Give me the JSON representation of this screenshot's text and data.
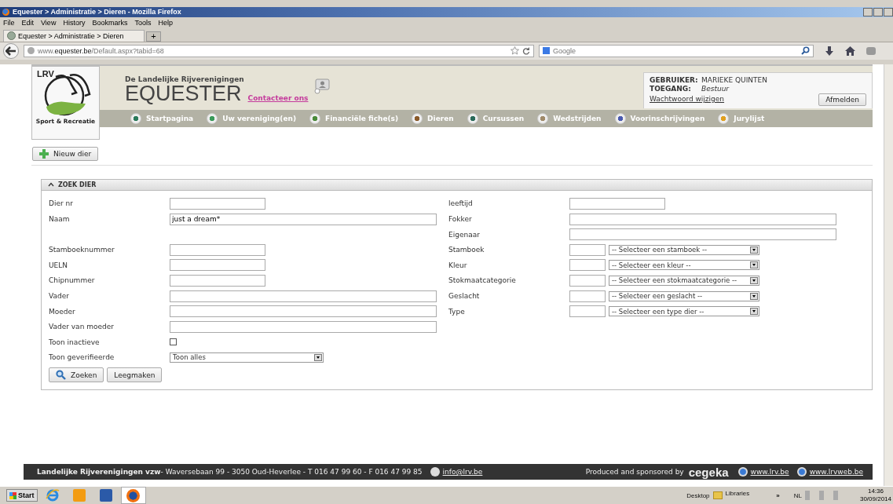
{
  "window": {
    "title": "Equester > Administratie > Dieren - Mozilla Firefox"
  },
  "menu": [
    "File",
    "Edit",
    "View",
    "History",
    "Bookmarks",
    "Tools",
    "Help"
  ],
  "tabs": [
    {
      "label": "Equester > Administratie > Dieren",
      "selected": true
    }
  ],
  "tab_add": "+",
  "address_bar": {
    "url": "www.**equester.be**/Default.aspx?tabid=68"
  },
  "search_bar": {
    "placeholder": "Google"
  },
  "header": {
    "logo_title": "LRV",
    "logo_caption": "Sport & Recreatie",
    "org": "De Landelijke Rijverenigingen",
    "app": "EQUESTER",
    "contact_link": "Contacteer ons"
  },
  "user_box": {
    "user_label": "GEBRUIKER:",
    "user": "MARIEKE QUINTEN",
    "access_label": "TOEGANG:",
    "access": "Bestuur",
    "password_link": "Wachtwoord wijzigen",
    "logout": "Afmelden"
  },
  "nav": [
    "Startpagina",
    "Uw vereniging(en)",
    "Financiële fiche(s)",
    "Dieren",
    "Cursussen",
    "Wedstrijden",
    "Voorinschrijvingen",
    "Jurylijst"
  ],
  "new_button": "Nieuw dier",
  "panel": {
    "title": "ZOEK DIER",
    "expanded": true,
    "rows": [
      {
        "left": {
          "kind": "short_text",
          "label": "Dier nr"
        },
        "right": {
          "kind": "short_text",
          "label": "leeftijd"
        }
      },
      {
        "left": {
          "kind": "text",
          "label": "Naam",
          "value": "just a dream*"
        },
        "right": {
          "kind": "text",
          "label": "Fokker"
        }
      },
      {
        "right": {
          "kind": "text",
          "label": "Eigenaar"
        }
      },
      {
        "left": {
          "kind": "short_text",
          "label": "Stamboeknummer"
        },
        "right": {
          "kind": "code_select",
          "label": "Stamboek",
          "value": "-- Selecteer een stamboek --"
        }
      },
      {
        "left": {
          "kind": "short_text",
          "label": "UELN"
        },
        "right": {
          "kind": "code_select",
          "label": "Kleur",
          "value": "-- Selecteer een kleur --"
        }
      },
      {
        "left": {
          "kind": "short_text",
          "label": "Chipnummer"
        },
        "right": {
          "kind": "code_select",
          "label": "Stokmaatcategorie",
          "value": "-- Selecteer een stokmaatcategorie --"
        }
      },
      {
        "left": {
          "kind": "text",
          "label": "Vader"
        },
        "right": {
          "kind": "code_select",
          "label": "Geslacht",
          "value": "-- Selecteer een geslacht --"
        }
      },
      {
        "left": {
          "kind": "text",
          "label": "Moeder"
        },
        "right": {
          "kind": "code_select",
          "label": "Type",
          "value": "-- Selecteer een type dier --"
        }
      },
      {
        "left": {
          "kind": "text",
          "label": "Vader van moeder"
        }
      },
      {
        "left": {
          "kind": "checkbox",
          "label": "Toon inactieve",
          "checked": false
        }
      },
      {
        "left": {
          "kind": "select",
          "label": "Toon geverifieerde",
          "value": "Toon alles"
        }
      }
    ],
    "buttons": [
      "Zoeken",
      "Leegmaken"
    ]
  },
  "footer": {
    "org": "Landelijke Rijverenigingen vzw",
    "address": " - Waversebaan 99 - 3050 Oud-Heverlee - T 016 47 99 60 - F 016 47 99 85",
    "email": "info@lrv.be",
    "sponsor": "Produced and sponsored by",
    "sponsor_logo": "cegeka",
    "links": [
      "www.lrv.be",
      "www.lrvweb.be"
    ]
  },
  "taskbar": {
    "start": "Start",
    "desktop": "Desktop",
    "libraries": "Libraries",
    "more": "»",
    "language": "NL",
    "time": "14:36",
    "date": "30/09/2014"
  }
}
